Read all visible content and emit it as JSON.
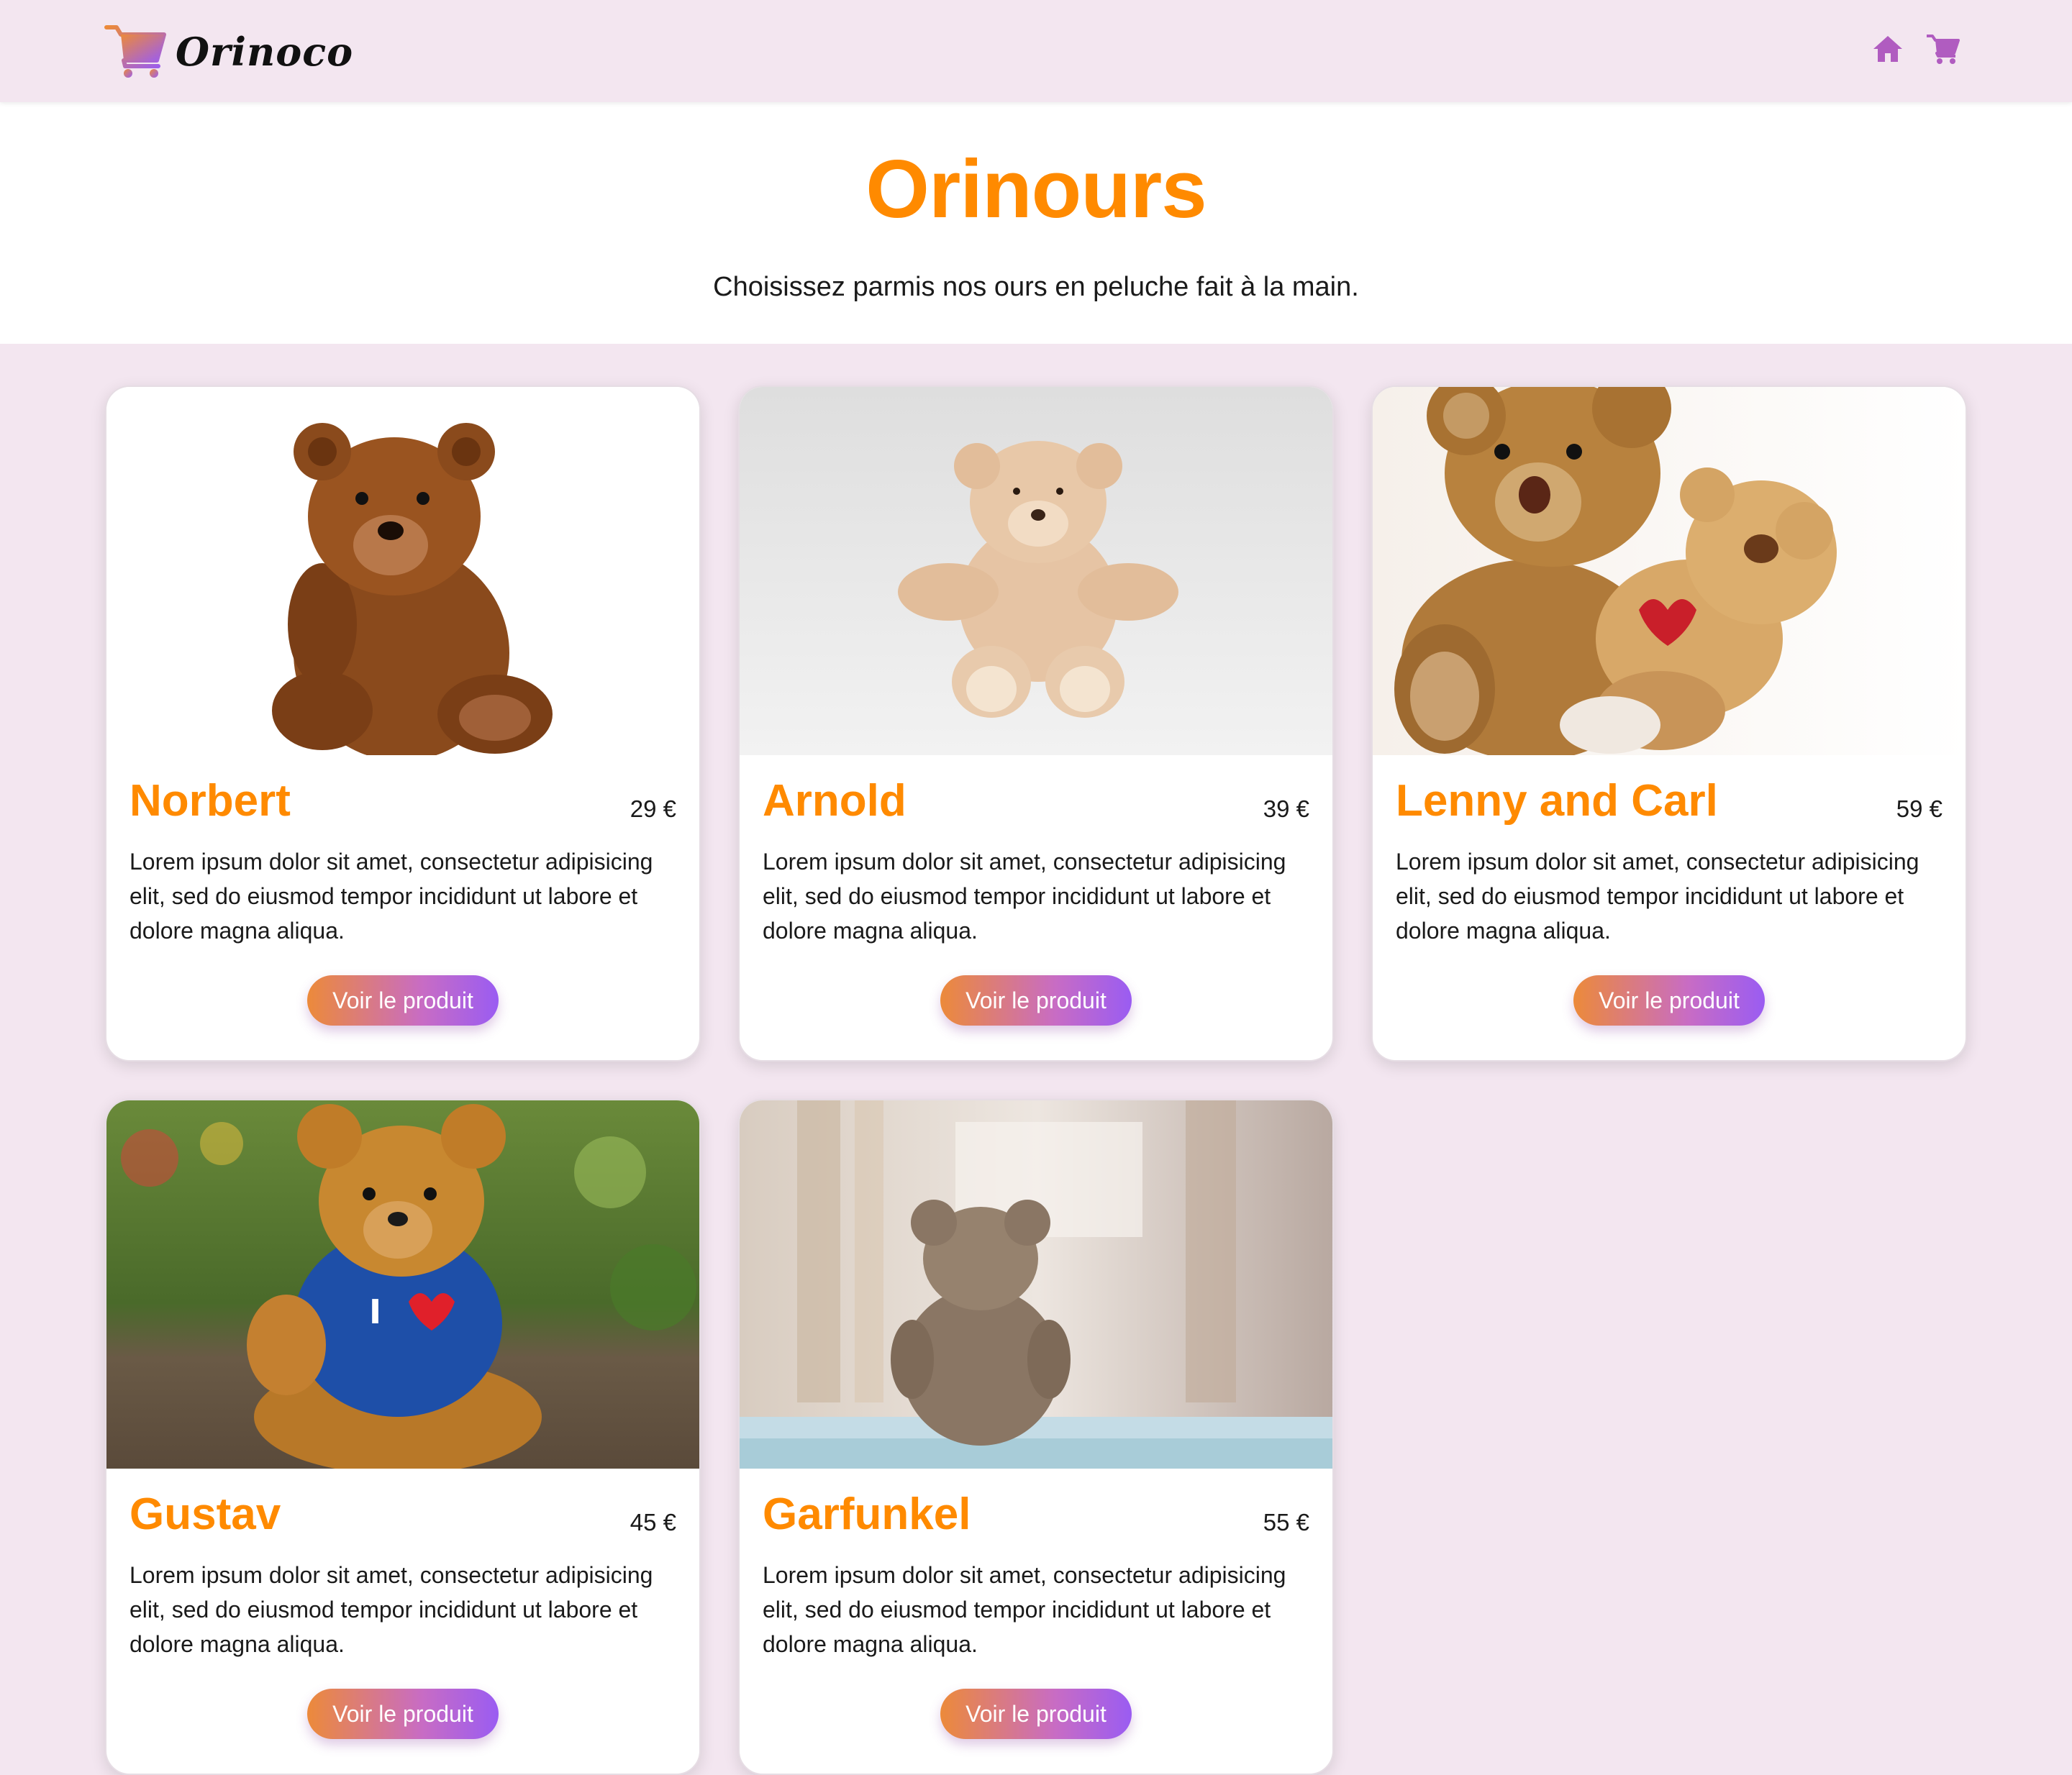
{
  "brand": {
    "name": "Orinoco",
    "logo_icon": "cart-logo-icon"
  },
  "nav": {
    "home_icon": "home-icon",
    "cart_icon": "cart-icon",
    "accent_color": "#b05cc0"
  },
  "hero": {
    "title": "Orinours",
    "subtitle": "Choisissez parmis nos ours en peluche fait à la main."
  },
  "colors": {
    "title_orange": "#ff8a00",
    "page_background": "#f3e6f0",
    "button_gradient_start": "#ec8a3a",
    "button_gradient_end": "#9a5cf2"
  },
  "products": [
    {
      "name": "Norbert",
      "price": "29 €",
      "description": "Lorem ipsum dolor sit amet, consectetur adipisicing elit, sed do eiusmod tempor incididunt ut labore et dolore magna aliqua.",
      "button": "Voir le produit"
    },
    {
      "name": "Arnold",
      "price": "39 €",
      "description": "Lorem ipsum dolor sit amet, consectetur adipisicing elit, sed do eiusmod tempor incididunt ut labore et dolore magna aliqua.",
      "button": "Voir le produit"
    },
    {
      "name": "Lenny and Carl",
      "price": "59 €",
      "description": "Lorem ipsum dolor sit amet, consectetur adipisicing elit, sed do eiusmod tempor incididunt ut labore et dolore magna aliqua.",
      "button": "Voir le produit"
    },
    {
      "name": "Gustav",
      "price": "45 €",
      "description": "Lorem ipsum dolor sit amet, consectetur adipisicing elit, sed do eiusmod tempor incididunt ut labore et dolore magna aliqua.",
      "button": "Voir le produit",
      "shirt_text": "I"
    },
    {
      "name": "Garfunkel",
      "price": "55 €",
      "description": "Lorem ipsum dolor sit amet, consectetur adipisicing elit, sed do eiusmod tempor incididunt ut labore et dolore magna aliqua.",
      "button": "Voir le produit"
    }
  ]
}
